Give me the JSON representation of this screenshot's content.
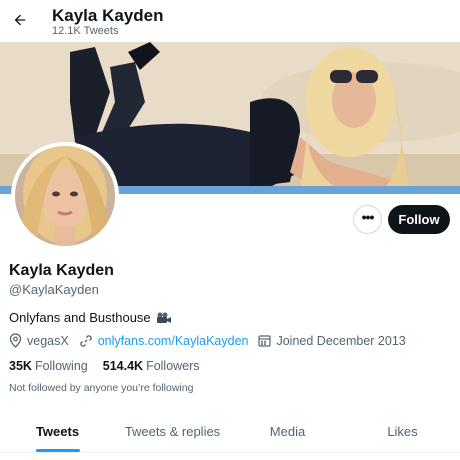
{
  "header": {
    "title": "Kayla Kayden",
    "tweet_count": "12.1K Tweets",
    "back_icon": "arrow-left-icon"
  },
  "profile": {
    "display_name": "Kayla Kayden",
    "handle": "@KaylaKayden",
    "bio": "Onlyfans and Busthouse",
    "bio_emoji": "movie-camera-icon",
    "location": "vegasX",
    "website": "onlyfans.com/KaylaKayden",
    "joined": "Joined December 2013",
    "not_followed_text": "Not followed by anyone you’re following"
  },
  "stats": {
    "following_count": "35K",
    "following_label": "Following",
    "followers_count": "514.4K",
    "followers_label": "Followers"
  },
  "actions": {
    "more_icon": "more-dots-icon",
    "follow_label": "Follow"
  },
  "tabs": [
    {
      "label": "Tweets",
      "active": true
    },
    {
      "label": "Tweets & replies",
      "active": false
    },
    {
      "label": "Media",
      "active": false
    },
    {
      "label": "Likes",
      "active": false
    }
  ],
  "colors": {
    "accent": "#1d9bf0",
    "text_primary": "#0f1419",
    "text_secondary": "#536471",
    "follow_bg": "#0f1419"
  }
}
